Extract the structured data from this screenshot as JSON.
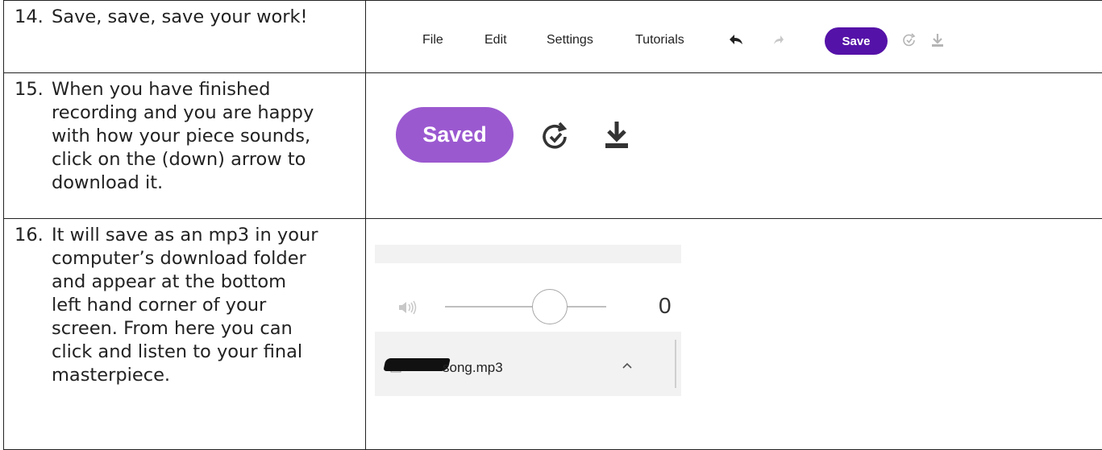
{
  "steps": [
    {
      "number": "14.",
      "lines": [
        "Save, save, save your work!"
      ]
    },
    {
      "number": "15.",
      "lines": [
        "When you have finished",
        "recording and you are happy",
        "with how your piece sounds,",
        "click on the (down) arrow to",
        "download it."
      ]
    },
    {
      "number": "16.",
      "lines": [
        "It will save as an mp3 in your",
        "computer’s download folder",
        "and appear at the bottom",
        "left hand corner of your",
        "screen. From here you can",
        "click and listen to your final",
        "masterpiece."
      ]
    }
  ],
  "toolbar": {
    "menu": [
      "File",
      "Edit",
      "Settings",
      "Tutorials"
    ],
    "save_label": "Save",
    "save_color": "#5512a8"
  },
  "saved_panel": {
    "saved_label": "Saved",
    "saved_color": "#9b59d0"
  },
  "download_bar": {
    "volume_value": "0",
    "volume_level": 0.65,
    "file_name": "song.mp3"
  }
}
